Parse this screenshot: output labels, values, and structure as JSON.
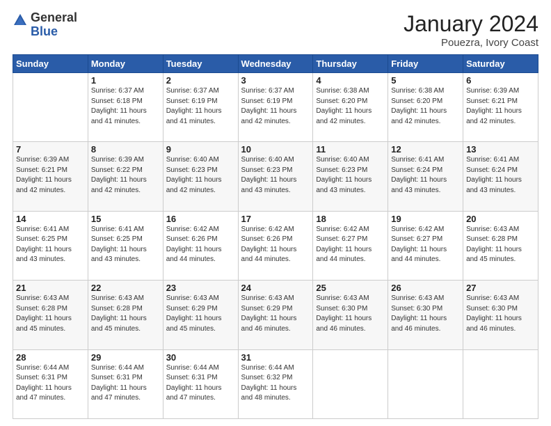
{
  "logo": {
    "general": "General",
    "blue": "Blue"
  },
  "header": {
    "month": "January 2024",
    "location": "Pouezra, Ivory Coast"
  },
  "weekdays": [
    "Sunday",
    "Monday",
    "Tuesday",
    "Wednesday",
    "Thursday",
    "Friday",
    "Saturday"
  ],
  "weeks": [
    [
      {
        "day": "",
        "sunrise": "",
        "sunset": "",
        "daylight": ""
      },
      {
        "day": "1",
        "sunrise": "Sunrise: 6:37 AM",
        "sunset": "Sunset: 6:18 PM",
        "daylight": "Daylight: 11 hours and 41 minutes."
      },
      {
        "day": "2",
        "sunrise": "Sunrise: 6:37 AM",
        "sunset": "Sunset: 6:19 PM",
        "daylight": "Daylight: 11 hours and 41 minutes."
      },
      {
        "day": "3",
        "sunrise": "Sunrise: 6:37 AM",
        "sunset": "Sunset: 6:19 PM",
        "daylight": "Daylight: 11 hours and 42 minutes."
      },
      {
        "day": "4",
        "sunrise": "Sunrise: 6:38 AM",
        "sunset": "Sunset: 6:20 PM",
        "daylight": "Daylight: 11 hours and 42 minutes."
      },
      {
        "day": "5",
        "sunrise": "Sunrise: 6:38 AM",
        "sunset": "Sunset: 6:20 PM",
        "daylight": "Daylight: 11 hours and 42 minutes."
      },
      {
        "day": "6",
        "sunrise": "Sunrise: 6:39 AM",
        "sunset": "Sunset: 6:21 PM",
        "daylight": "Daylight: 11 hours and 42 minutes."
      }
    ],
    [
      {
        "day": "7",
        "sunrise": "Sunrise: 6:39 AM",
        "sunset": "Sunset: 6:21 PM",
        "daylight": "Daylight: 11 hours and 42 minutes."
      },
      {
        "day": "8",
        "sunrise": "Sunrise: 6:39 AM",
        "sunset": "Sunset: 6:22 PM",
        "daylight": "Daylight: 11 hours and 42 minutes."
      },
      {
        "day": "9",
        "sunrise": "Sunrise: 6:40 AM",
        "sunset": "Sunset: 6:23 PM",
        "daylight": "Daylight: 11 hours and 42 minutes."
      },
      {
        "day": "10",
        "sunrise": "Sunrise: 6:40 AM",
        "sunset": "Sunset: 6:23 PM",
        "daylight": "Daylight: 11 hours and 43 minutes."
      },
      {
        "day": "11",
        "sunrise": "Sunrise: 6:40 AM",
        "sunset": "Sunset: 6:23 PM",
        "daylight": "Daylight: 11 hours and 43 minutes."
      },
      {
        "day": "12",
        "sunrise": "Sunrise: 6:41 AM",
        "sunset": "Sunset: 6:24 PM",
        "daylight": "Daylight: 11 hours and 43 minutes."
      },
      {
        "day": "13",
        "sunrise": "Sunrise: 6:41 AM",
        "sunset": "Sunset: 6:24 PM",
        "daylight": "Daylight: 11 hours and 43 minutes."
      }
    ],
    [
      {
        "day": "14",
        "sunrise": "Sunrise: 6:41 AM",
        "sunset": "Sunset: 6:25 PM",
        "daylight": "Daylight: 11 hours and 43 minutes."
      },
      {
        "day": "15",
        "sunrise": "Sunrise: 6:41 AM",
        "sunset": "Sunset: 6:25 PM",
        "daylight": "Daylight: 11 hours and 43 minutes."
      },
      {
        "day": "16",
        "sunrise": "Sunrise: 6:42 AM",
        "sunset": "Sunset: 6:26 PM",
        "daylight": "Daylight: 11 hours and 44 minutes."
      },
      {
        "day": "17",
        "sunrise": "Sunrise: 6:42 AM",
        "sunset": "Sunset: 6:26 PM",
        "daylight": "Daylight: 11 hours and 44 minutes."
      },
      {
        "day": "18",
        "sunrise": "Sunrise: 6:42 AM",
        "sunset": "Sunset: 6:27 PM",
        "daylight": "Daylight: 11 hours and 44 minutes."
      },
      {
        "day": "19",
        "sunrise": "Sunrise: 6:42 AM",
        "sunset": "Sunset: 6:27 PM",
        "daylight": "Daylight: 11 hours and 44 minutes."
      },
      {
        "day": "20",
        "sunrise": "Sunrise: 6:43 AM",
        "sunset": "Sunset: 6:28 PM",
        "daylight": "Daylight: 11 hours and 45 minutes."
      }
    ],
    [
      {
        "day": "21",
        "sunrise": "Sunrise: 6:43 AM",
        "sunset": "Sunset: 6:28 PM",
        "daylight": "Daylight: 11 hours and 45 minutes."
      },
      {
        "day": "22",
        "sunrise": "Sunrise: 6:43 AM",
        "sunset": "Sunset: 6:28 PM",
        "daylight": "Daylight: 11 hours and 45 minutes."
      },
      {
        "day": "23",
        "sunrise": "Sunrise: 6:43 AM",
        "sunset": "Sunset: 6:29 PM",
        "daylight": "Daylight: 11 hours and 45 minutes."
      },
      {
        "day": "24",
        "sunrise": "Sunrise: 6:43 AM",
        "sunset": "Sunset: 6:29 PM",
        "daylight": "Daylight: 11 hours and 46 minutes."
      },
      {
        "day": "25",
        "sunrise": "Sunrise: 6:43 AM",
        "sunset": "Sunset: 6:30 PM",
        "daylight": "Daylight: 11 hours and 46 minutes."
      },
      {
        "day": "26",
        "sunrise": "Sunrise: 6:43 AM",
        "sunset": "Sunset: 6:30 PM",
        "daylight": "Daylight: 11 hours and 46 minutes."
      },
      {
        "day": "27",
        "sunrise": "Sunrise: 6:43 AM",
        "sunset": "Sunset: 6:30 PM",
        "daylight": "Daylight: 11 hours and 46 minutes."
      }
    ],
    [
      {
        "day": "28",
        "sunrise": "Sunrise: 6:44 AM",
        "sunset": "Sunset: 6:31 PM",
        "daylight": "Daylight: 11 hours and 47 minutes."
      },
      {
        "day": "29",
        "sunrise": "Sunrise: 6:44 AM",
        "sunset": "Sunset: 6:31 PM",
        "daylight": "Daylight: 11 hours and 47 minutes."
      },
      {
        "day": "30",
        "sunrise": "Sunrise: 6:44 AM",
        "sunset": "Sunset: 6:31 PM",
        "daylight": "Daylight: 11 hours and 47 minutes."
      },
      {
        "day": "31",
        "sunrise": "Sunrise: 6:44 AM",
        "sunset": "Sunset: 6:32 PM",
        "daylight": "Daylight: 11 hours and 48 minutes."
      },
      {
        "day": "",
        "sunrise": "",
        "sunset": "",
        "daylight": ""
      },
      {
        "day": "",
        "sunrise": "",
        "sunset": "",
        "daylight": ""
      },
      {
        "day": "",
        "sunrise": "",
        "sunset": "",
        "daylight": ""
      }
    ]
  ]
}
